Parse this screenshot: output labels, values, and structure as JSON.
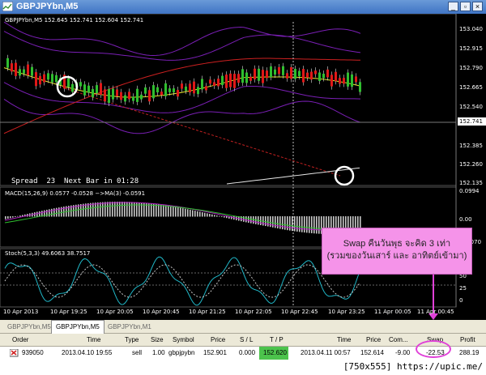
{
  "window": {
    "title": "GBPJPYbn,M5"
  },
  "chart": {
    "header": "GBPJPYbn,M5 152.645 152.741 152.604 152.741",
    "current_price": "152.741",
    "spread_text": "Spread  23  Next Bar in 01:28",
    "macd_label": "MACD(15,26,9) 0.0577 -0.0528 −>MA(3) -0.0591",
    "stoch_label": "Stoch(5,3,3) 49.6063 38.7517",
    "price_axis": [
      "153.040",
      "152.915",
      "152.790",
      "152.665",
      "152.540",
      "152.385",
      "152.260",
      "152.135"
    ],
    "macd_axis": [
      "0.0994",
      "0.00",
      "-0.1070"
    ],
    "stoch_axis": [
      "100",
      "75",
      "50",
      "25",
      "0"
    ],
    "time_axis": [
      "10 Apr 2013",
      "10 Apr 19:25",
      "10 Apr 20:05",
      "10 Apr 20:45",
      "10 Apr 21:25",
      "10 Apr 22:05",
      "10 Apr 22:45",
      "10 Apr 23:25",
      "11 Apr 00:05",
      "11 Apr 00:45"
    ],
    "colors": {
      "bull": "#2fbf2f",
      "bear": "#e01818",
      "bands": "#7a1fb5",
      "ma_fast": "#e6e628",
      "ma_slow": "#cc2020",
      "lower_curve": "#e8e8e8",
      "macd_hist": "#c8c8c8",
      "macd_signal": "#b020c0",
      "stoch_main": "#20b8c8",
      "stoch_signal": "#c8c8c8"
    }
  },
  "annotation": {
    "line1": "Swap คืนวันพุธ จะคิด 3 เท่า",
    "line2": "(รวมของวันเสาร์ และ อาทิตย์เข้ามา)",
    "color": "#f593e9"
  },
  "tabs": [
    "GBPJPYbn,M5",
    "GBPJPYbn,M5",
    "GBPJPYbn,M1"
  ],
  "table": {
    "headers": [
      "Order",
      "Time",
      "Type",
      "Size",
      "Symbol",
      "Price",
      "S / L",
      "T / P",
      "Time",
      "Price",
      "Com...",
      "Swap",
      "Profit"
    ],
    "row": {
      "order": "939050",
      "time": "2013.04.10 19:55",
      "type": "sell",
      "size": "1.00",
      "symbol": "gbpjpybn",
      "price": "152.901",
      "sl": "0.000",
      "tp": "152.620",
      "close_time": "2013.04.11 00:57",
      "close_price": "152.614",
      "commission": "-9.00",
      "swap": "-22.53",
      "profit": "288.19"
    }
  },
  "watermark": "[750x555] https://upic.me/"
}
